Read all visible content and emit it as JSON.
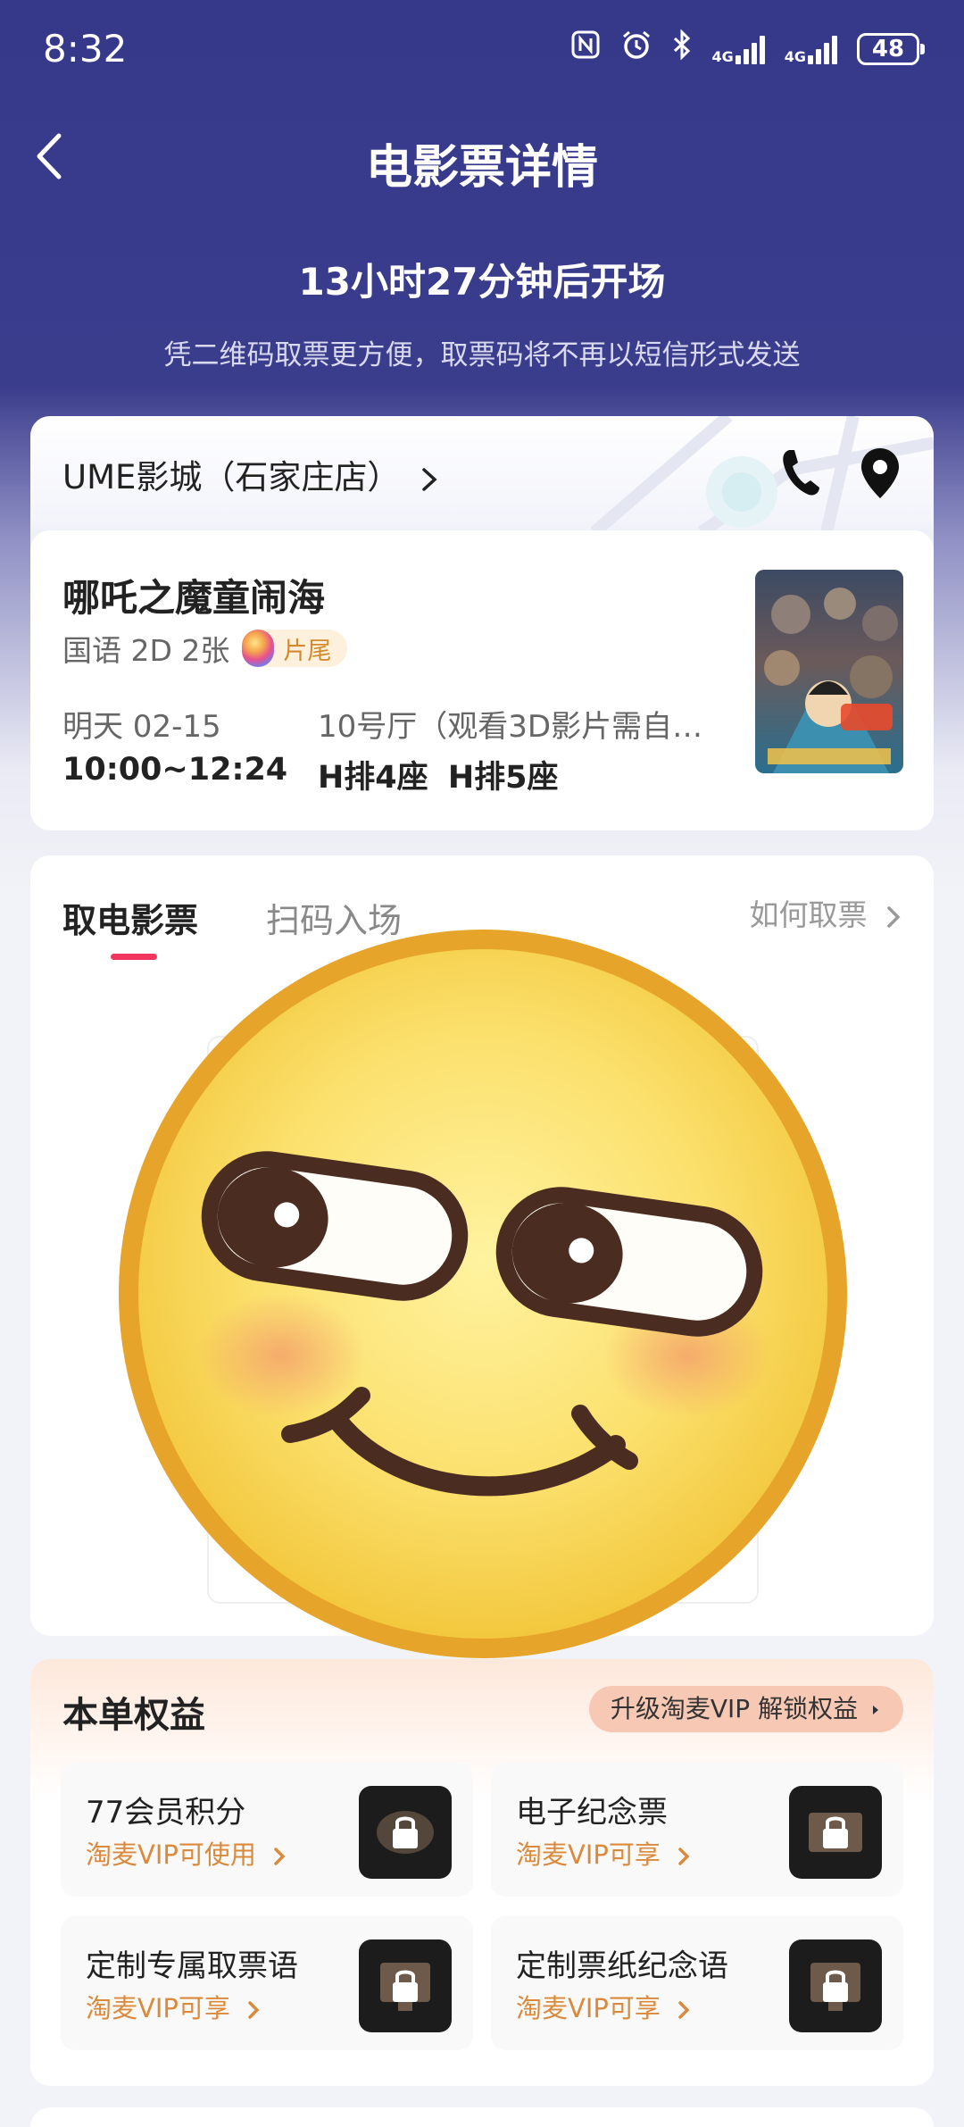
{
  "status": {
    "time": "8:32",
    "net1": "4G",
    "net2": "4G",
    "battery": "48"
  },
  "header": {
    "title": "电影票详情"
  },
  "countdown": "13小时27分钟后开场",
  "hint": "凭二维码取票更方便，取票码将不再以短信形式发送",
  "cinema": {
    "name": "UME影城（石家庄店）"
  },
  "movie": {
    "title": "哪吒之魔童闹海",
    "meta": "国语 2D 2张",
    "tag": "片尾",
    "date": "明天 02-15",
    "time": "10:00~12:24",
    "hall": "10号厅（观看3D影片需自…",
    "seats": "H排4座 H排5座"
  },
  "ticket_tabs": {
    "active": "取电影票",
    "inactive": "扫码入场",
    "how_link": "如何取票"
  },
  "benefits": {
    "title": "本单权益",
    "vip_pill": "升级淘麦VIP 解锁权益",
    "items": [
      {
        "name": "77会员积分",
        "sub": "淘麦VIP可使用"
      },
      {
        "name": "电子纪念票",
        "sub": "淘麦VIP可享"
      },
      {
        "name": "定制专属取票语",
        "sub": "淘麦VIP可享"
      },
      {
        "name": "定制票纸纪念语",
        "sub": "淘麦VIP可享"
      }
    ]
  },
  "colors": {
    "header_bg": "#36388a",
    "accent": "#f0365f",
    "vip_orange": "#d98a3c"
  },
  "icons": [
    "back-arrow-icon",
    "phone-icon",
    "location-pin-icon",
    "chevron-right-icon",
    "lock-icon",
    "emoji-smile-icon"
  ]
}
